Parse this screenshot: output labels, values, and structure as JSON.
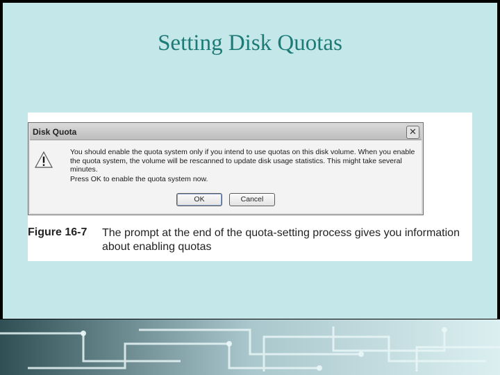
{
  "slide": {
    "title": "Setting Disk Quotas"
  },
  "dialog": {
    "title": "Disk Quota",
    "close_icon": "close-icon",
    "warning_icon": "warning-icon",
    "message": "You should enable the quota system only if you intend to use quotas on this disk volume.  When you enable the quota system, the volume will be rescanned to update disk usage statistics. This might take several minutes.",
    "prompt": "Press OK to enable the quota system now.",
    "ok_label": "OK",
    "cancel_label": "Cancel"
  },
  "figure": {
    "number": "Figure 16-7",
    "caption": "The prompt at the end of the quota-setting process gives you information about enabling quotas"
  },
  "colors": {
    "panel": "#c4e7e9",
    "title": "#1c7b76",
    "background": "#000000"
  }
}
